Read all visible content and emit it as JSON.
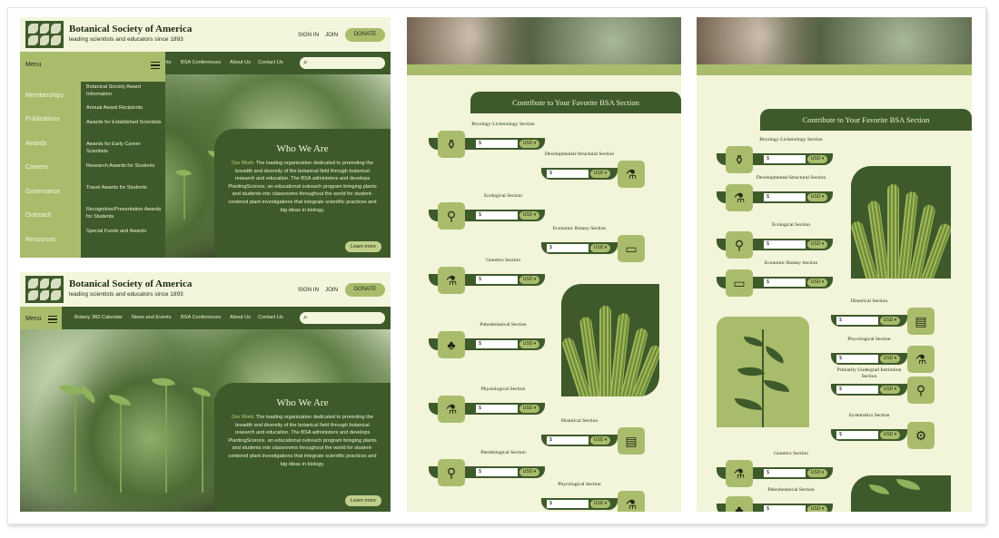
{
  "header": {
    "org_name": "Botanical Society of America",
    "tagline": "leading scientists and educators since 1893",
    "sign_in": "SIGN IN",
    "join": "JOIN",
    "donate": "DONATE",
    "search_icon": "search-icon"
  },
  "nav_top": [
    "nts",
    "BSA Conferences",
    "About Us",
    "Contact Us"
  ],
  "nav_full": {
    "menu": "Menu",
    "items": [
      "Botany 360 Calendar",
      "News and Events",
      "BSA Conferences",
      "About Us",
      "Contact Us"
    ]
  },
  "menu": {
    "label": "Menu",
    "categories": [
      "Memberships",
      "Publications",
      "Awards",
      "Careers",
      "Governance",
      "Outreach",
      "Resources"
    ],
    "active": "Awards",
    "sub_items": [
      "Botanical Society Award Information",
      "Annual Award Recipients",
      "Awards for Established Scientists",
      "Awards for Early Career Scientists",
      "Research Awards for Students",
      "Travel Awards for Students",
      "Recognition/Presentation Awards for Students",
      "Special Funds and Awards"
    ]
  },
  "who": {
    "title": "Who We Are",
    "lead": "Our Work:",
    "body": "The leading organization dedicated to promoting the breadth and diversity of the botanical field through botanical research and education. The BSA administers and develops PlantingScience, an educational outreach program bringing plants and students into classrooms throughout the world for student-centered plant investigations that integrate scientific practices and big ideas in biology.",
    "learn_more": "Learn more"
  },
  "contribute": {
    "title": "Contribute to Your Favorite BSA Section",
    "currency_symbol": "$",
    "currency": "USD"
  },
  "sections_mid": [
    {
      "name": "Bryology-Lichenology Section",
      "icon": "jar-icon"
    },
    {
      "name": "Developmental-Structural Section",
      "icon": "lab-glassware-icon"
    },
    {
      "name": "Ecological Section",
      "icon": "test-tube-icon"
    },
    {
      "name": "Economic Botany Section",
      "icon": "monitor-icon"
    },
    {
      "name": "Genetics Section",
      "icon": "flask-icon"
    },
    {
      "name": "Paleobotanical Section",
      "icon": "sprout-icon"
    },
    {
      "name": "Physiological Section",
      "icon": "beaker-icon"
    },
    {
      "name": "Historical Section",
      "icon": "document-icon"
    },
    {
      "name": "Pteridological Section",
      "icon": "microscope-icon"
    },
    {
      "name": "Phycological Section",
      "icon": "beaker-icon"
    }
  ],
  "sections_right": [
    {
      "name": "Bryology-Lichenology Section",
      "icon": "jar-icon"
    },
    {
      "name": "Developmental-Structural Section",
      "icon": "lab-glassware-icon"
    },
    {
      "name": "Ecological Section",
      "icon": "test-tube-icon"
    },
    {
      "name": "Economic Botany Section",
      "icon": "monitor-icon"
    },
    {
      "name": "Historical Section",
      "icon": "document-icon"
    },
    {
      "name": "Phycological Section",
      "icon": "beaker-icon"
    },
    {
      "name": "Primarily Undergrad Institution Section",
      "icon": "microscope-icon"
    },
    {
      "name": "Systematics Section",
      "icon": "gear-icon"
    },
    {
      "name": "Genetics Section",
      "icon": "flask-icon"
    },
    {
      "name": "Paleobotanical Section",
      "icon": "sprout-icon"
    }
  ],
  "colors": {
    "dark_green": "#3e5a2b",
    "light_green": "#a9bc6c",
    "cream": "#f2f5da"
  }
}
